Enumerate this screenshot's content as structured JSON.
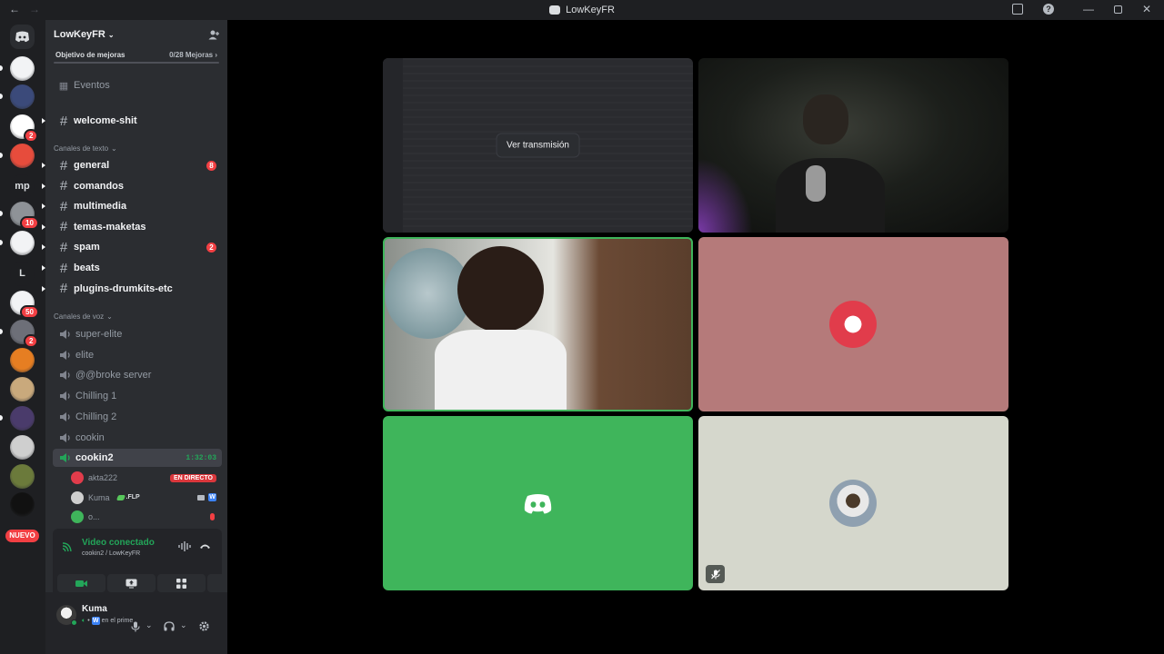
{
  "window": {
    "title": "LowKeyFR"
  },
  "rail": {
    "servers": [
      {
        "name": "server-1",
        "type": "image",
        "color": "#f2f3f5",
        "pip": true
      },
      {
        "name": "server-2",
        "type": "image",
        "color": "#3b4a7a",
        "pip": true
      },
      {
        "name": "server-3",
        "type": "image",
        "color": "#ffffff",
        "badge": "2",
        "pip": false
      },
      {
        "name": "server-4",
        "type": "image",
        "color": "#e74c3c",
        "pip": true
      },
      {
        "name": "server-mp",
        "type": "text",
        "label": "mp"
      },
      {
        "name": "server-6",
        "type": "image",
        "color": "#8e9297",
        "badge": "10",
        "pip": true
      },
      {
        "name": "server-7",
        "type": "image",
        "color": "#f2f3f5",
        "pip": true
      },
      {
        "name": "server-l",
        "type": "text",
        "label": "L"
      },
      {
        "name": "server-9",
        "type": "image",
        "color": "#f2f3f5",
        "badge": "50"
      },
      {
        "name": "server-10",
        "type": "image",
        "color": "#6d6f78",
        "badge": "2",
        "pip": true
      },
      {
        "name": "server-11",
        "type": "image",
        "color": "#e67e22"
      },
      {
        "name": "server-12",
        "type": "image",
        "color": "#c9a97c"
      },
      {
        "name": "server-13",
        "type": "image",
        "color": "#4a3b6b",
        "pip": true
      },
      {
        "name": "server-14",
        "type": "image",
        "color": "#cfcfcf"
      },
      {
        "name": "server-15",
        "type": "image",
        "color": "#6b7a3b"
      },
      {
        "name": "server-16",
        "type": "image",
        "color": "#111111"
      }
    ],
    "new_label": "NUEVO"
  },
  "server": {
    "name": "LowKeyFR",
    "boost_goal": "Objetivo de mejoras",
    "boost_count": "0/28 Mejoras",
    "events": "Eventos",
    "welcome": "welcome-shit",
    "text_category": "Canales de texto",
    "text_channels": [
      {
        "name": "general",
        "badge": "8"
      },
      {
        "name": "comandos"
      },
      {
        "name": "multimedia"
      },
      {
        "name": "temas-maketas"
      },
      {
        "name": "spam",
        "badge": "2"
      },
      {
        "name": "beats"
      },
      {
        "name": "plugins-drumkits-etc"
      }
    ],
    "voice_category": "Canales de voz",
    "voice_channels": [
      "super-elite",
      "elite",
      "@@broke server",
      "Chilling 1",
      "Chilling 2",
      "cookin"
    ],
    "active_voice": {
      "name": "cookin2",
      "timer": "1:32:03"
    },
    "voice_users": [
      {
        "name": "akta222",
        "live": "EN DIRECTO"
      },
      {
        "name": "Kuma",
        "tag": ".FLP",
        "w": "W"
      },
      {
        "name": "o..."
      }
    ]
  },
  "voice_panel": {
    "title": "Video conectado",
    "subtitle": "cookin2 / LowKeyFR"
  },
  "user_panel": {
    "name": "Kuma",
    "status_badge": "W",
    "status": "en el prime"
  },
  "stage": {
    "view_stream": "Ver transmisión",
    "accent_green": "#3fb55b",
    "pink_tile": "#b57a7a",
    "beige_tile": "#d5d7cc"
  }
}
